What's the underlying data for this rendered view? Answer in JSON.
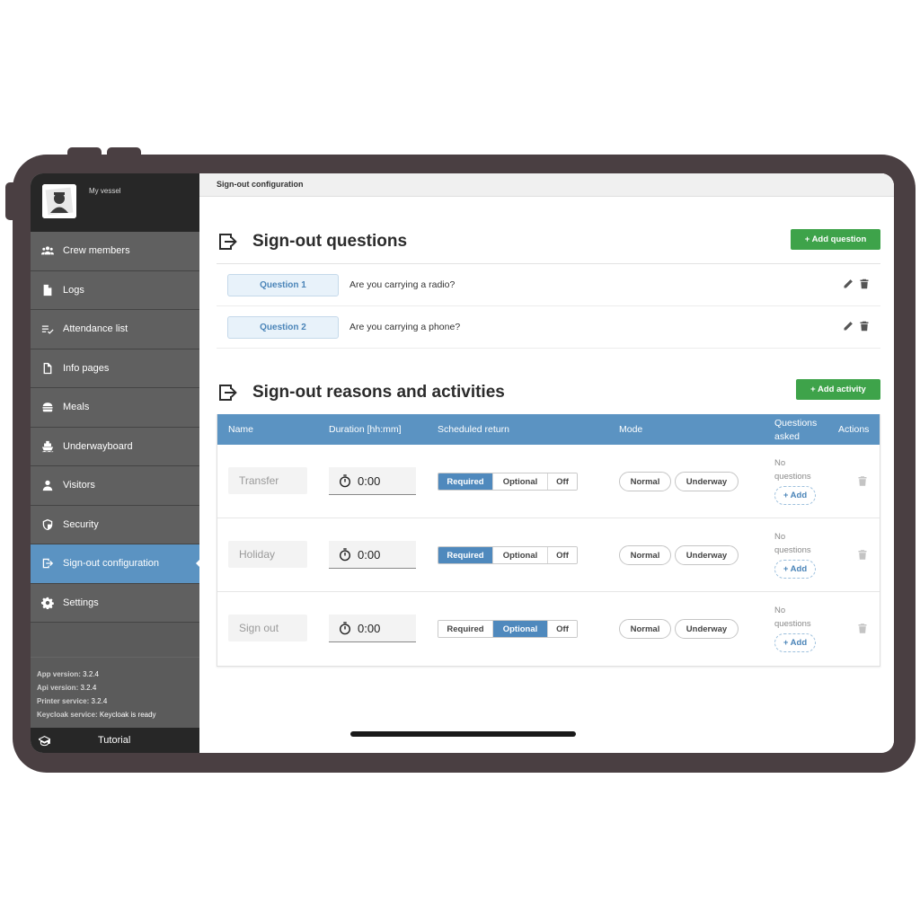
{
  "sidebar": {
    "vessel_name": "My vessel",
    "items": [
      {
        "label": "Crew members",
        "icon": "people-icon"
      },
      {
        "label": "Logs",
        "icon": "file-icon"
      },
      {
        "label": "Attendance list",
        "icon": "checklist-icon"
      },
      {
        "label": "Info pages",
        "icon": "page-icon"
      },
      {
        "label": "Meals",
        "icon": "burger-icon"
      },
      {
        "label": "Underwayboard",
        "icon": "ship-icon"
      },
      {
        "label": "Visitors",
        "icon": "person-icon"
      },
      {
        "label": "Security",
        "icon": "shield-icon"
      },
      {
        "label": "Sign-out configuration",
        "icon": "sign-out-icon",
        "active": true
      },
      {
        "label": "Settings",
        "icon": "gear-icon"
      }
    ],
    "versions": {
      "app_label": "App version:",
      "app_value": "3.2.4",
      "api_label": "Api version:",
      "api_value": "3.2.4",
      "printer_label": "Printer service:",
      "printer_value": "3.2.4",
      "keycloak_label": "Keycloak service:",
      "keycloak_value": "Keycloak is ready"
    },
    "tutorial_label": "Tutorial"
  },
  "topbar": {
    "title": "Sign-out configuration"
  },
  "questions_section": {
    "title": "Sign-out questions",
    "add_button": "+ Add question",
    "questions": [
      {
        "badge": "Question 1",
        "text": "Are you carrying a radio?"
      },
      {
        "badge": "Question 2",
        "text": "Are you carrying a phone?"
      }
    ]
  },
  "activities_section": {
    "title": "Sign-out reasons and activities",
    "add_button": "+ Add activity",
    "columns": {
      "name": "Name",
      "duration": "Duration [hh:mm]",
      "scheduled": "Scheduled return",
      "mode": "Mode",
      "questions_1": "Questions",
      "questions_2": "asked",
      "actions": "Actions"
    },
    "scheduled_options": [
      "Required",
      "Optional",
      "Off"
    ],
    "mode_options": [
      "Normal",
      "Underway"
    ],
    "no_questions_1": "No",
    "no_questions_2": "questions",
    "add_question_label": "+ Add",
    "rows": [
      {
        "name": "Transfer",
        "duration": "0:00",
        "scheduled": "Required"
      },
      {
        "name": "Holiday",
        "duration": "0:00",
        "scheduled": "Required"
      },
      {
        "name": "Sign out",
        "duration": "0:00",
        "scheduled": "Optional"
      }
    ]
  },
  "colors": {
    "frame": "#4a3f42",
    "sidebar": "#5b5b5b",
    "accent": "#5b93c2",
    "green": "#3ea34a"
  }
}
